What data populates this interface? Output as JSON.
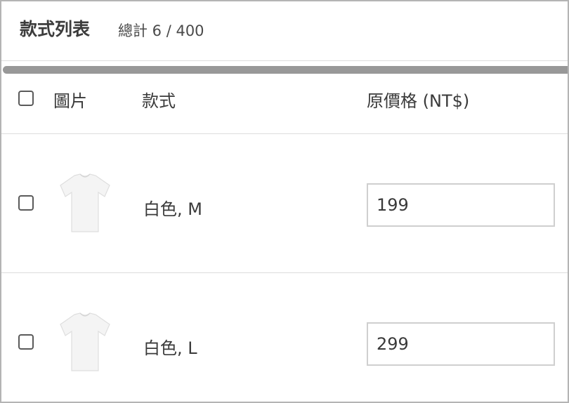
{
  "header": {
    "title": "款式列表",
    "count_text": "總計 6 / 400"
  },
  "table": {
    "columns": {
      "image": "圖片",
      "variant": "款式",
      "price": "原價格 (NT$)"
    },
    "rows": [
      {
        "variant": "白色, M",
        "price": "199",
        "image_icon": "white-tshirt",
        "checked": false
      },
      {
        "variant": "白色, L",
        "price": "299",
        "image_icon": "white-tshirt",
        "checked": false
      }
    ]
  },
  "colors": {
    "border": "#b4b4b4",
    "divider": "#dcdcdc",
    "scrollbar": "#989898",
    "input_border": "#cfcfcf"
  }
}
